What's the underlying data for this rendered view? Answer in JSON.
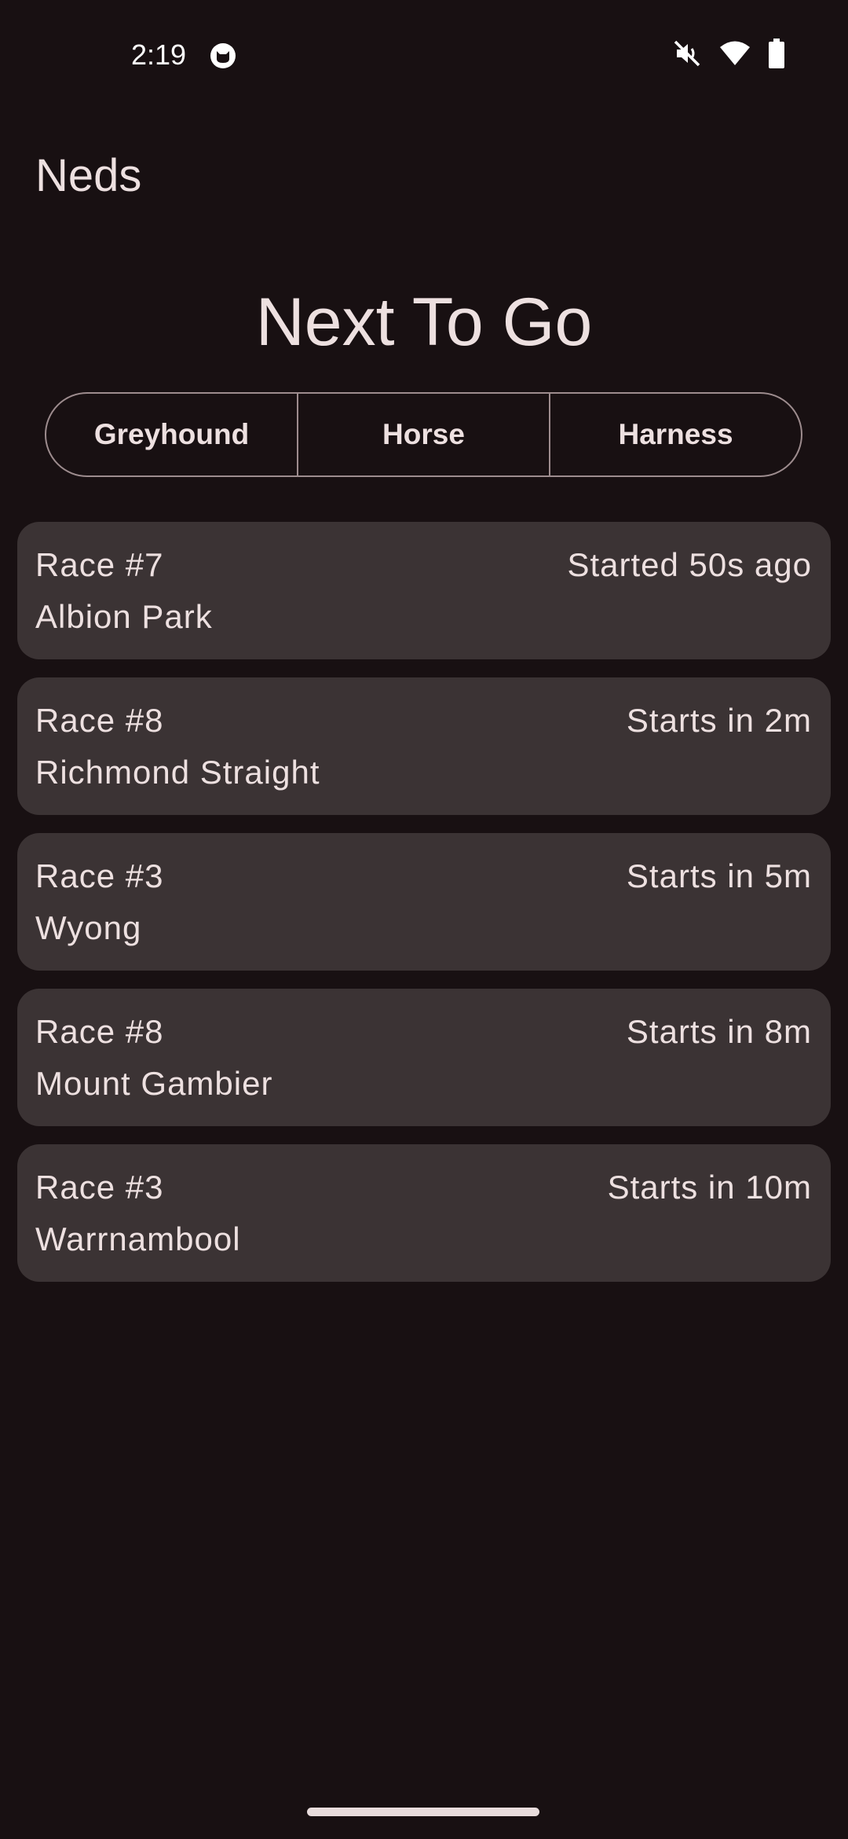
{
  "status_bar": {
    "time": "2:19",
    "icons": [
      "cat-notification-icon",
      "mute-icon",
      "wifi-icon",
      "battery-icon"
    ]
  },
  "app": {
    "title": "Neds"
  },
  "main": {
    "title": "Next To Go",
    "segments": [
      {
        "label": "Greyhound"
      },
      {
        "label": "Horse"
      },
      {
        "label": "Harness"
      }
    ],
    "races": [
      {
        "number": "Race #7",
        "venue": "Albion Park",
        "status": "Started 50s ago"
      },
      {
        "number": "Race #8",
        "venue": "Richmond Straight",
        "status": "Starts in 2m"
      },
      {
        "number": "Race #3",
        "venue": "Wyong",
        "status": "Starts in 5m"
      },
      {
        "number": "Race #8",
        "venue": "Mount Gambier",
        "status": "Starts in 8m"
      },
      {
        "number": "Race #3",
        "venue": "Warrnambool",
        "status": "Starts in 10m"
      }
    ]
  },
  "colors": {
    "background": "#181012",
    "card": "#3b3334",
    "text": "#ede0e0",
    "outline": "#9d8c8e"
  }
}
